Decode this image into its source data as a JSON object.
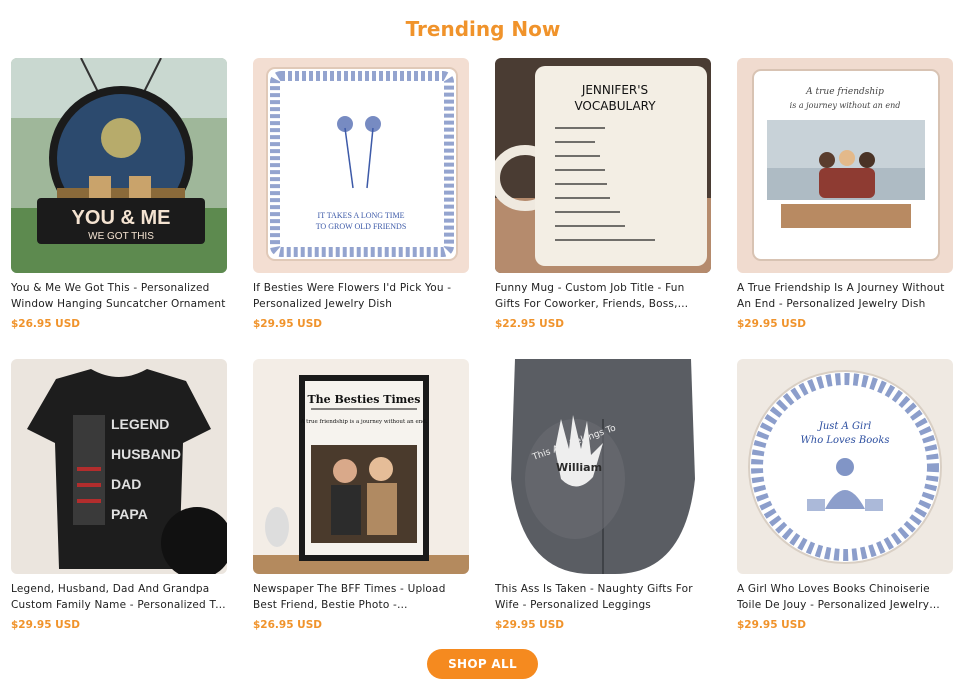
{
  "section": {
    "title": "Trending Now"
  },
  "products": [
    {
      "title": "You & Me We Got This - Personalized Window Hanging Suncatcher Ornament",
      "price": "$26.95 USD",
      "thumb": {
        "bg": "#7a9b73",
        "accent": "#2a2a2a",
        "caption1": "YOU & ME",
        "caption2": "WE GOT THIS",
        "icon": "suncatcher-ornament"
      }
    },
    {
      "title": "If Besties Were Flowers I'd Pick You - Personalized Jewelry Dish",
      "price": "$29.95 USD",
      "thumb": {
        "bg": "#f2ddd0",
        "accent": "#3d5aa8",
        "caption1": "IT TAKES A LONG TIME",
        "caption2": "TO GROW OLD FRIENDS",
        "icon": "jewelry-dish"
      }
    },
    {
      "title": "Funny Mug - Custom Job Title - Fun Gifts For Coworker, Friends, Boss, Colleagues",
      "price": "$22.95 USD",
      "thumb": {
        "bg": "#6b5a4e",
        "accent": "#111111",
        "caption1": "JENNIFER'S",
        "caption2": "VOCABULARY",
        "icon": "mug"
      }
    },
    {
      "title": "A True Friendship Is A Journey Without An End - Personalized Jewelry Dish",
      "price": "$29.95 USD",
      "thumb": {
        "bg": "#f0d9cc",
        "accent": "#7b5b4a",
        "caption1": "A true friendship",
        "caption2": "is a journey without an end",
        "icon": "jewelry-dish"
      }
    },
    {
      "title": "Legend, Husband, Dad And Grandpa Custom Family Name - Personalized T-Shirt",
      "price": "$29.95 USD",
      "thumb": {
        "bg": "#e9e2da",
        "accent": "#1c1c1c",
        "caption1": "LEGEND",
        "caption2": "HUSBAND",
        "caption3": "DAD",
        "caption4": "PAPA",
        "icon": "t-shirt"
      }
    },
    {
      "title": "Newspaper The BFF Times - Upload Best Friend, Bestie Photo - Personalized Poster",
      "price": "$26.95 USD",
      "thumb": {
        "bg": "#f3ede6",
        "accent": "#1a1a1a",
        "caption1": "The Besties Times",
        "caption2": "A true friendship is a journey without an end.",
        "icon": "poster"
      }
    },
    {
      "title": "This Ass Is Taken - Naughty Gifts For Wife - Personalized Leggings",
      "price": "$29.95 USD",
      "thumb": {
        "bg": "#ffffff",
        "accent": "#55585e",
        "caption1": "This Ass Belongs To",
        "caption2": "William",
        "icon": "leggings"
      }
    },
    {
      "title": "A Girl Who Loves Books Chinoiserie Toile De Jouy - Personalized Jewelry Dish",
      "price": "$29.95 USD",
      "thumb": {
        "bg": "#efe9e2",
        "accent": "#2d4fa0",
        "caption1": "Just A Girl",
        "caption2": "Who Loves Books",
        "icon": "plate"
      }
    }
  ],
  "cta": {
    "label": "SHOP ALL"
  },
  "colors": {
    "accent": "#f0932b",
    "button": "#f58a1f"
  }
}
